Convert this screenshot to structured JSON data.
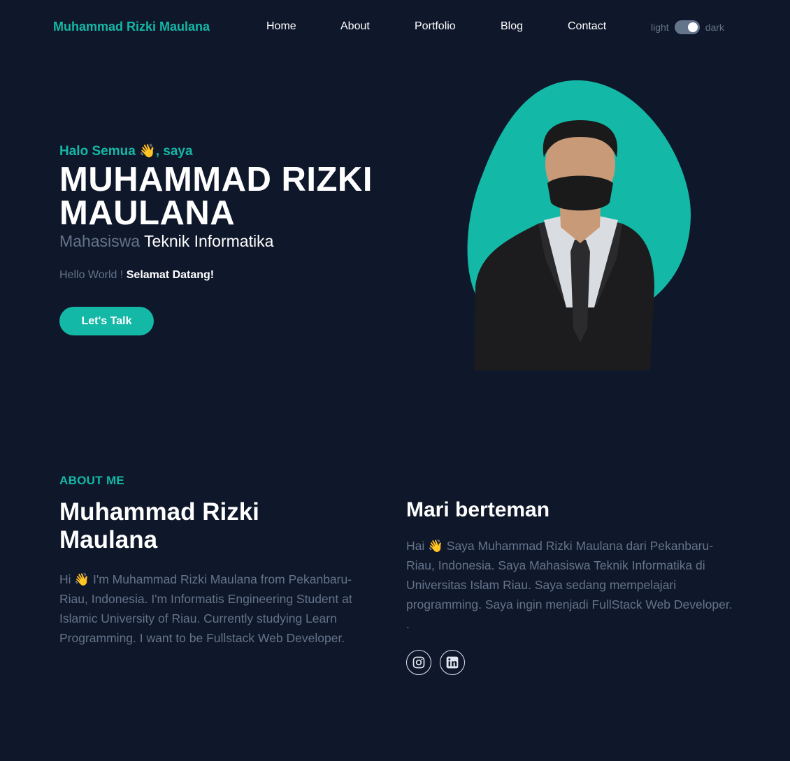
{
  "header": {
    "brand": "Muhammad Rizki Maulana",
    "nav": [
      "Home",
      "About",
      "Portfolio",
      "Blog",
      "Contact"
    ],
    "theme_light_label": "light",
    "theme_dark_label": "dark",
    "theme_mode": "dark"
  },
  "hero": {
    "greeting": "Halo Semua 👋, saya",
    "name": "MUHAMMAD RIZKI MAULANA",
    "role_muted": "Mahasiswa",
    "role_strong": "Teknik Informatika",
    "hello_muted": "Hello World !",
    "hello_bold": "Selamat Datang!",
    "cta_label": "Let's Talk"
  },
  "about": {
    "eyebrow": "ABOUT ME",
    "title": "Muhammad Rizki Maulana",
    "text": "Hi 👋 I'm Muhammad Rizki Maulana from Pekanbaru-Riau, Indonesia. I'm Informatis Engineering Student at Islamic University of Riau. Currently studying Learn Programming. I want to be Fullstack Web Developer.",
    "friends_title": "Mari berteman",
    "friends_text": "Hai 👋 Saya Muhammad Rizki Maulana dari Pekanbaru-Riau, Indonesia. Saya Mahasiswa Teknik Informatika di Universitas Islam Riau. Saya sedang mempelajari programming. Saya ingin menjadi FullStack Web Developer. .",
    "socials": [
      "instagram-icon",
      "linkedin-icon"
    ]
  },
  "colors": {
    "background": "#0f172a",
    "accent": "#14b8a6",
    "muted": "#64748b",
    "text": "#ffffff"
  }
}
